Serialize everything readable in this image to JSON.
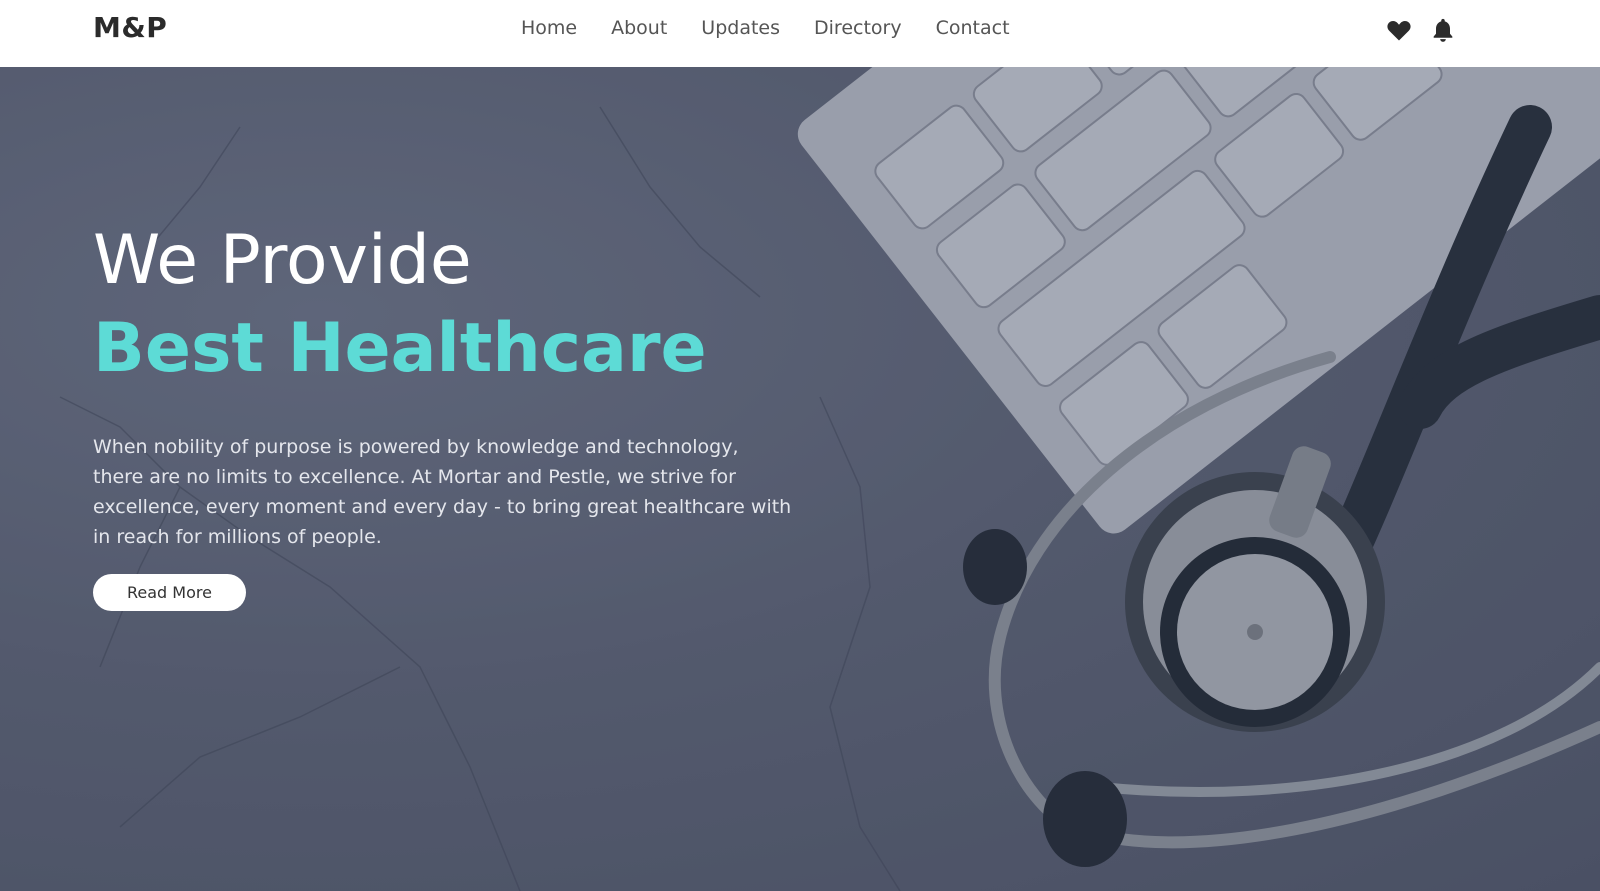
{
  "brand": {
    "logo_text": "M&P"
  },
  "nav": {
    "items": [
      {
        "label": "Home"
      },
      {
        "label": "About"
      },
      {
        "label": "Updates"
      },
      {
        "label": "Directory"
      },
      {
        "label": "Contact"
      }
    ],
    "icons": [
      "heart-icon",
      "bell-icon"
    ]
  },
  "hero": {
    "line1": "We Provide",
    "line2": "Best Healthcare",
    "description": "When nobility of purpose is powered by knowledge and technology, there are no limits to excellence. At Mortar and Pestle, we strive for excellence, every moment and every day - to bring great healthcare with in reach for millions of people.",
    "cta_label": "Read More",
    "accent_color": "#5ddbd6"
  }
}
